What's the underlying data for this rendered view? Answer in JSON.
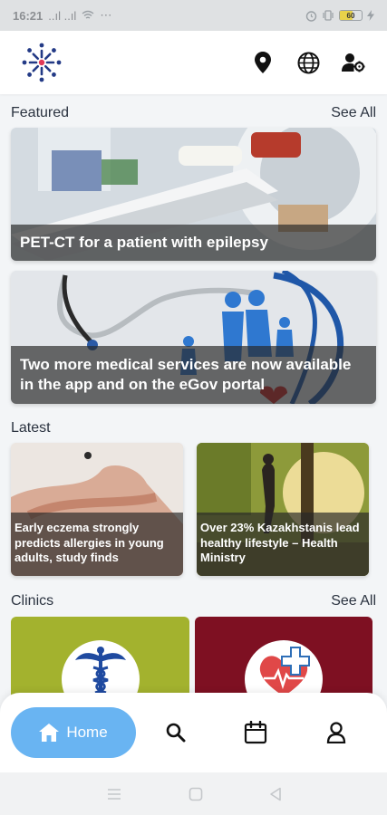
{
  "status_bar": {
    "time": "16:21",
    "signal_text": "..ıl ..ıl",
    "extra_text": "⋯",
    "battery_level": "60",
    "battery_fraction": 0.6
  },
  "header": {
    "logo_icon": "brand-flower-logo",
    "actions": [
      {
        "name": "location",
        "icon": "map-pin-icon"
      },
      {
        "name": "language",
        "icon": "globe-icon"
      },
      {
        "name": "account-settings",
        "icon": "user-gear-icon"
      }
    ]
  },
  "featured": {
    "title": "Featured",
    "see_all": "See All",
    "items": [
      {
        "caption": "PET-CT for a patient with epilepsy"
      },
      {
        "caption": "Two more medical services are now available in the app and on the eGov portal"
      }
    ]
  },
  "latest": {
    "title": "Latest",
    "items": [
      {
        "caption": "Early eczema strongly predicts allergies in young adults, study finds"
      },
      {
        "caption": "Over 23% Kazakhstanis lead healthy lifestyle – Health Ministry"
      }
    ]
  },
  "clinics": {
    "title": "Clinics",
    "see_all": "See All",
    "items": [
      {
        "color": "#a3b22e",
        "logo_icon": "caduceus-icon"
      },
      {
        "color": "#7e1022",
        "logo_icon": "heart-cross-icon"
      }
    ]
  },
  "bottom_nav": {
    "home_label": "Home",
    "items": [
      "home-icon",
      "search-icon",
      "calendar-icon",
      "profile-icon"
    ],
    "active_color": "#69b4f2"
  }
}
